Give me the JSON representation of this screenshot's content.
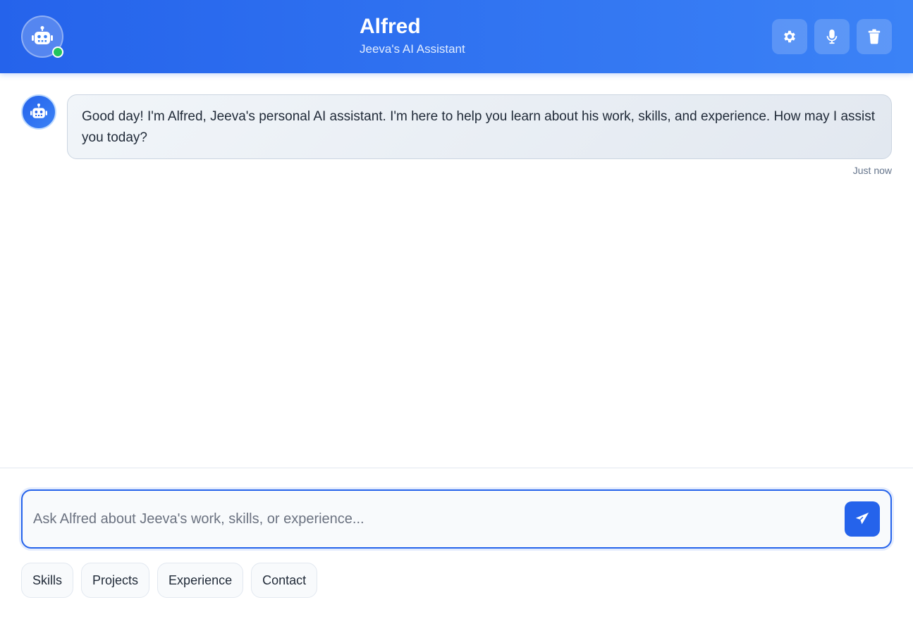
{
  "header": {
    "title": "Alfred",
    "subtitle": "Jeeva's AI Assistant",
    "avatar_icon": "robot-icon",
    "status": "online",
    "buttons": [
      {
        "name": "settings",
        "icon": "gear-icon"
      },
      {
        "name": "voice",
        "icon": "microphone-icon"
      },
      {
        "name": "clear",
        "icon": "trash-icon"
      }
    ]
  },
  "messages": [
    {
      "sender": "assistant",
      "text": "Good day! I'm Alfred, Jeeva's personal AI assistant. I'm here to help you learn about his work, skills, and experience. How may I assist you today?",
      "time": "Just now"
    }
  ],
  "composer": {
    "placeholder": "Ask Alfred about Jeeva's work, skills, or experience...",
    "value": "",
    "send_icon": "paper-plane-icon"
  },
  "quick_replies": [
    "Skills",
    "Projects",
    "Experience",
    "Contact"
  ],
  "colors": {
    "accent": "#2563eb",
    "accent_light": "#3b82f6",
    "online": "#22c55e"
  }
}
